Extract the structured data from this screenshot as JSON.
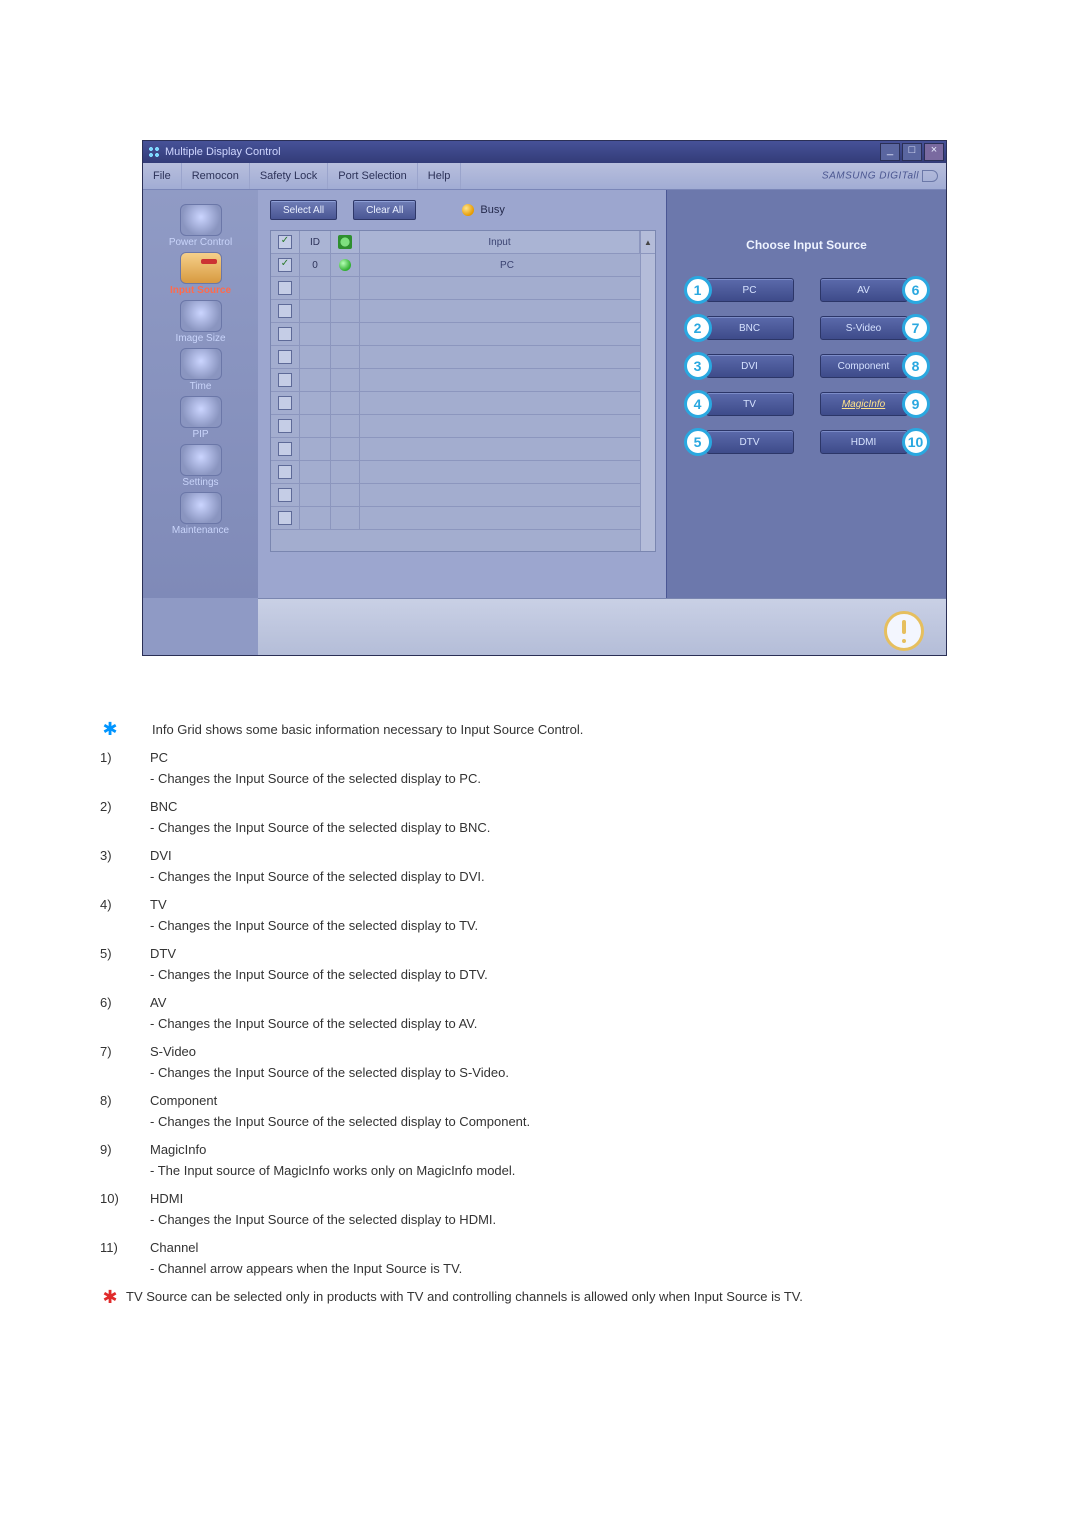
{
  "app": {
    "title": "Multiple Display Control",
    "brand": "SAMSUNG DIGITall"
  },
  "menubar": [
    "File",
    "Remocon",
    "Safety Lock",
    "Port Selection",
    "Help"
  ],
  "sidebar": [
    {
      "label": "Power Control"
    },
    {
      "label": "Input Source",
      "active": true
    },
    {
      "label": "Image Size"
    },
    {
      "label": "Time"
    },
    {
      "label": "PIP"
    },
    {
      "label": "Settings"
    },
    {
      "label": "Maintenance"
    }
  ],
  "toolbar": {
    "select_all": "Select All",
    "clear_all": "Clear All",
    "busy_label": "Busy"
  },
  "grid": {
    "header_id": "ID",
    "header_input": "Input",
    "rows": [
      {
        "checked": true,
        "id": "0",
        "status": true,
        "input": "PC"
      },
      {
        "checked": false,
        "id": "",
        "status": false,
        "input": ""
      },
      {
        "checked": false,
        "id": "",
        "status": false,
        "input": ""
      },
      {
        "checked": false,
        "id": "",
        "status": false,
        "input": ""
      },
      {
        "checked": false,
        "id": "",
        "status": false,
        "input": ""
      },
      {
        "checked": false,
        "id": "",
        "status": false,
        "input": ""
      },
      {
        "checked": false,
        "id": "",
        "status": false,
        "input": ""
      },
      {
        "checked": false,
        "id": "",
        "status": false,
        "input": ""
      },
      {
        "checked": false,
        "id": "",
        "status": false,
        "input": ""
      },
      {
        "checked": false,
        "id": "",
        "status": false,
        "input": ""
      },
      {
        "checked": false,
        "id": "",
        "status": false,
        "input": ""
      },
      {
        "checked": false,
        "id": "",
        "status": false,
        "input": ""
      }
    ]
  },
  "right": {
    "title": "Choose Input Source",
    "left_col": [
      {
        "n": "1",
        "l": "PC"
      },
      {
        "n": "2",
        "l": "BNC"
      },
      {
        "n": "3",
        "l": "DVI"
      },
      {
        "n": "4",
        "l": "TV"
      },
      {
        "n": "5",
        "l": "DTV"
      }
    ],
    "right_col": [
      {
        "n": "6",
        "l": "AV"
      },
      {
        "n": "7",
        "l": "S-Video"
      },
      {
        "n": "8",
        "l": "Component"
      },
      {
        "n": "9",
        "l": "MagicInfo",
        "magic": true
      },
      {
        "n": "10",
        "l": "HDMI"
      }
    ]
  },
  "doc": {
    "intro": "Info Grid shows some basic information necessary to Input Source Control.",
    "items": [
      {
        "n": "1)",
        "t": "PC",
        "d": "- Changes the Input Source of the selected display to PC."
      },
      {
        "n": "2)",
        "t": "BNC",
        "d": "- Changes the Input Source of the selected display to BNC."
      },
      {
        "n": "3)",
        "t": "DVI",
        "d": "- Changes the Input Source of the selected display to DVI."
      },
      {
        "n": "4)",
        "t": "TV",
        "d": "- Changes the Input Source of the selected display to TV."
      },
      {
        "n": "5)",
        "t": "DTV",
        "d": "- Changes the Input Source of the selected display to DTV."
      },
      {
        "n": "6)",
        "t": "AV",
        "d": "- Changes the Input Source of the selected display to AV."
      },
      {
        "n": "7)",
        "t": "S-Video",
        "d": "- Changes the Input Source of the selected display to S-Video."
      },
      {
        "n": "8)",
        "t": "Component",
        "d": "- Changes the Input Source of the selected display to Component."
      },
      {
        "n": "9)",
        "t": "MagicInfo",
        "d": "- The Input source of MagicInfo works only on MagicInfo model."
      },
      {
        "n": "10)",
        "t": "HDMI",
        "d": "- Changes the Input Source of the selected display to HDMI."
      },
      {
        "n": "11)",
        "t": "Channel",
        "d": "- Channel arrow appears when the Input Source is TV."
      }
    ],
    "footnote": "TV Source can be selected only in products with TV and controlling channels is allowed only when Input Source is TV."
  }
}
